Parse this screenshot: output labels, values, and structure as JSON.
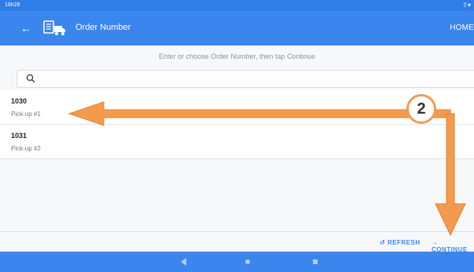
{
  "status_bar": {
    "time": "16h28",
    "signal": "⇧▾"
  },
  "app_bar": {
    "title": "Order Number",
    "home_label": "HOME"
  },
  "main": {
    "prompt": "Enter or choose Order Number, then tap Continue",
    "search": {
      "placeholder": "",
      "value": ""
    },
    "orders": [
      {
        "number": "1030",
        "label": "Pick-up #1"
      },
      {
        "number": "1031",
        "label": "Pick-up #2"
      }
    ]
  },
  "footer": {
    "refresh_label": "REFRESH",
    "continue_label": "CONTINUE"
  },
  "annotation": {
    "step_number": "2",
    "color": "#f39a4e"
  },
  "colors": {
    "primary": "#3b86ee",
    "status_bar": "#2f7de6"
  }
}
